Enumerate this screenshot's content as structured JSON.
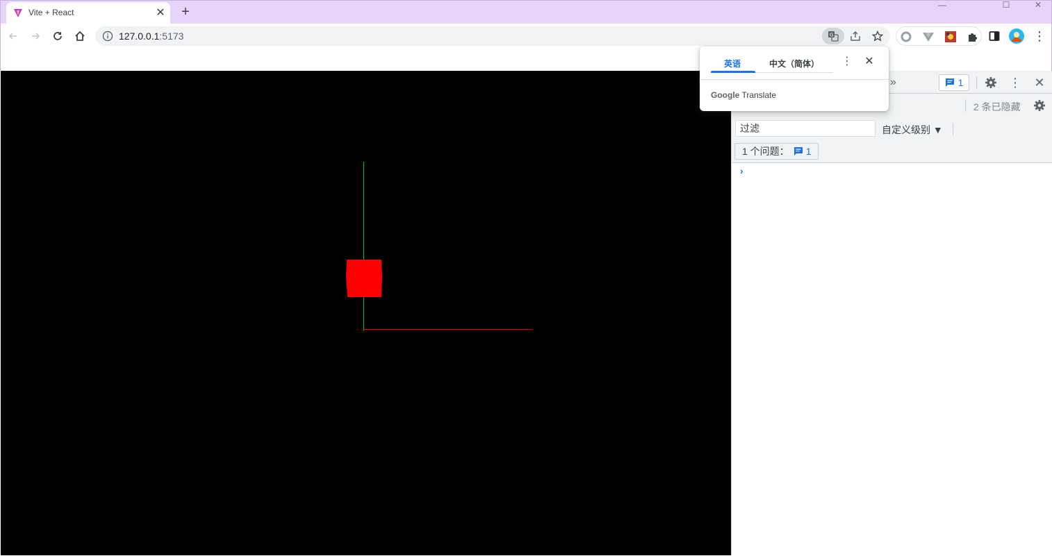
{
  "tab": {
    "title": "Vite + React",
    "favicon": "vite-icon",
    "close_glyph": "✕"
  },
  "new_tab_glyph": "+",
  "window_controls": {
    "minimize": "—",
    "maximize": "☐",
    "close": "✕"
  },
  "toolbar": {
    "url_host": "127.0.0.1",
    "url_port": ":5173",
    "icons": [
      "back-icon",
      "forward-icon",
      "reload-icon",
      "home-icon",
      "info-icon",
      "translate-icon",
      "share-icon",
      "star-icon"
    ],
    "extensions": [
      "circle-extension-icon",
      "vue-devtools-icon",
      "image-extension-icon",
      "puzzle-icon",
      "side-panel-icon",
      "profile-avatar"
    ],
    "menu_glyph": "⋮"
  },
  "scene": {
    "background": "#000000",
    "cube_color": "#ff0000",
    "x_axis_color": "#ff0000",
    "y_axis_color": "#00ff00"
  },
  "devtools": {
    "more_tabs_glyph": "»",
    "issues_badge_count": "1",
    "hidden_count": "2 条已隐藏",
    "filter_placeholder": "过滤",
    "levels_label": "自定义级别 ▼",
    "issues_label": "1 个问题：",
    "issues_count": "1",
    "prompt_glyph": "›",
    "close_glyph": "✕",
    "menu_glyph": "⋮"
  },
  "translate_popup": {
    "source_language": "英语",
    "target_language": "中文（简体）",
    "brand_google": "Google",
    "brand_translate": "Translate",
    "menu_glyph": "⋮",
    "close_glyph": "✕"
  }
}
